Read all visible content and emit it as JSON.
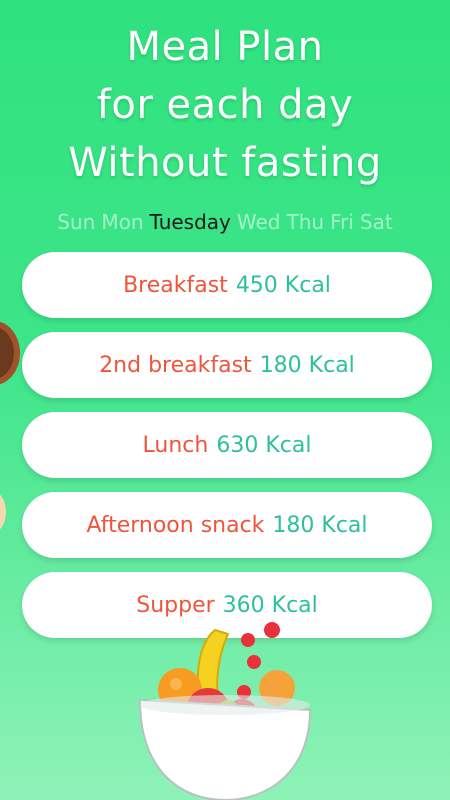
{
  "headline": {
    "line1": "Meal Plan",
    "line2": "for each day",
    "line3": "Without fasting"
  },
  "days": [
    "Sun",
    "Mon",
    "Tuesday",
    "Wed",
    "Thu",
    "Fri",
    "Sat"
  ],
  "selected_day": "Tuesday",
  "meals": [
    {
      "name": "Breakfast",
      "kcal": "450 Kcal"
    },
    {
      "name": "2nd breakfast",
      "kcal": "180 Kcal"
    },
    {
      "name": "Lunch",
      "kcal": "630 Kcal"
    },
    {
      "name": "Afternoon snack",
      "kcal": "180 Kcal"
    },
    {
      "name": "Supper",
      "kcal": "360 Kcal"
    }
  ],
  "colors": {
    "background": "#3ee58a",
    "meal_name": "#f0543a",
    "kcal": "#2ebf9e",
    "selected_day": "#1b1b1b"
  },
  "icons": [
    "fruit-bowl-icon",
    "donut-icon",
    "fruit-edge-icon"
  ]
}
